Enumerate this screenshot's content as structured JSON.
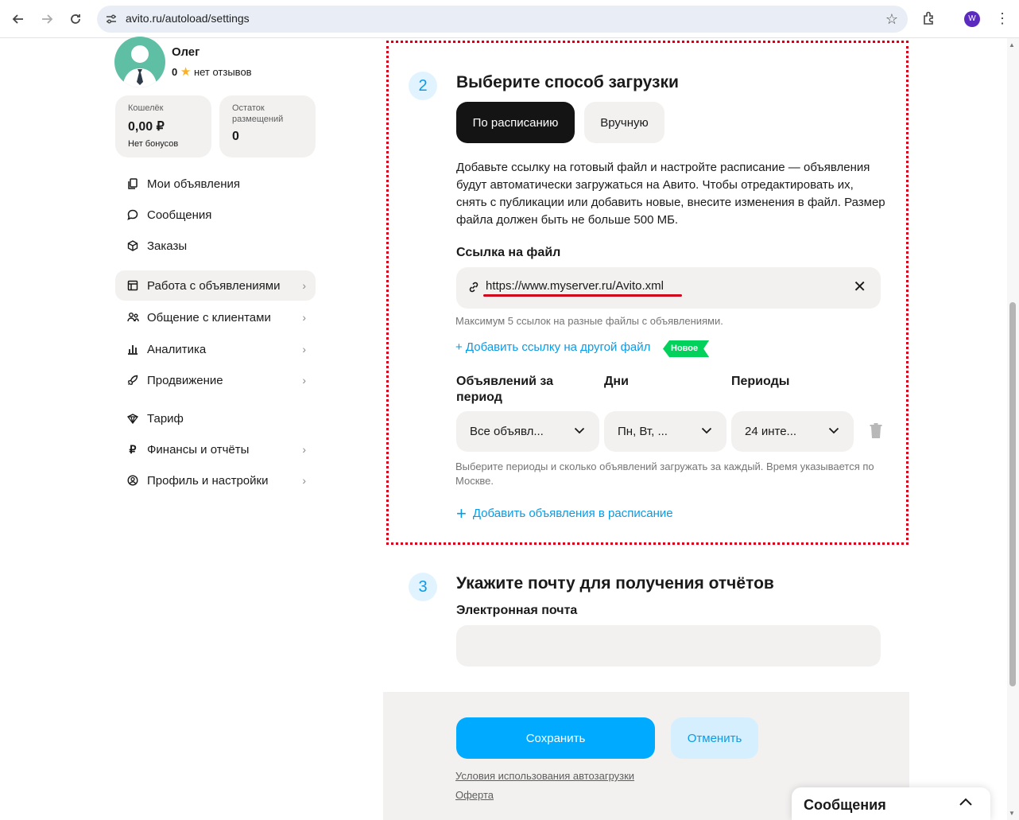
{
  "browser": {
    "url": "avito.ru/autoload/settings",
    "profile_letter": "W"
  },
  "sidebar": {
    "user_name": "Олег",
    "rating_count": "0",
    "reviews": "нет отзывов",
    "wallet": {
      "label": "Кошелёк",
      "value": "0,00 ₽",
      "sub": "Нет бонусов"
    },
    "balance": {
      "label": "Остаток размещений",
      "value": "0"
    },
    "items": [
      {
        "label": "Мои объявления",
        "icon": "copy-icon"
      },
      {
        "label": "Сообщения",
        "icon": "chat-icon"
      },
      {
        "label": "Заказы",
        "icon": "box-icon"
      },
      {
        "label": "Работа с объявлениями",
        "icon": "ads-work-icon",
        "active": true
      },
      {
        "label": "Общение с клиентами",
        "icon": "people-icon"
      },
      {
        "label": "Аналитика",
        "icon": "chart-icon"
      },
      {
        "label": "Продвижение",
        "icon": "rocket-icon"
      },
      {
        "label": "Тариф",
        "icon": "tariff-icon"
      },
      {
        "label": "Финансы и отчёты",
        "icon": "ruble-icon"
      },
      {
        "label": "Профиль и настройки",
        "icon": "profile-icon"
      }
    ]
  },
  "step2": {
    "num": "2",
    "title": "Выберите способ загрузки",
    "toggle_schedule": "По расписанию",
    "toggle_manual": "Вручную",
    "description": "Добавьте ссылку на готовый файл и настройте расписание — объявления будут автоматически загружаться на Авито. Чтобы отредактировать их, снять с публикации или добавить новые, внесите изменения в файл. Размер файла должен быть не больше 500 МБ.",
    "file_link_label": "Ссылка на файл",
    "file_link_value": "https://www.myserver.ru/Avito.xml",
    "file_hint": "Максимум 5 ссылок на разные файлы с объявлениями.",
    "add_link": "+ Добавить ссылку на другой файл",
    "new_badge": "Новое",
    "col_ads": "Объявлений за период",
    "col_days": "Дни",
    "col_periods": "Периоды",
    "select_ads": "Все объявл...",
    "select_days": "Пн, Вт, ...",
    "select_periods": "24 инте...",
    "schedule_hint": "Выберите периоды и сколько объявлений загружать за каждый. Время указывается по Москве.",
    "add_schedule": "Добавить объявления в расписание"
  },
  "step3": {
    "num": "3",
    "title": "Укажите почту для получения отчётов",
    "email_label": "Электронная почта",
    "email_value": ""
  },
  "footer": {
    "save": "Сохранить",
    "cancel": "Отменить",
    "terms": "Условия использования автозагрузки",
    "offer": "Оферта"
  },
  "messages_widget": {
    "title": "Сообщения"
  },
  "colors": {
    "accent": "#00aaff",
    "link": "#0a9be6",
    "badge": "#02d15c",
    "highlight": "#d0021b"
  }
}
